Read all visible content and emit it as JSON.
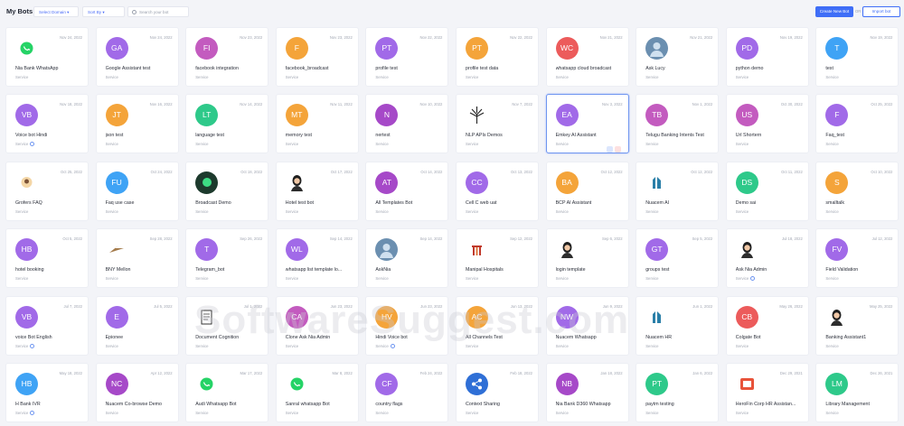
{
  "header": {
    "title": "My Bots",
    "select_team": "Select Domain",
    "sort_by": "Sort By",
    "search_placeholder": "Search your bot",
    "create_label": "Create New Bot",
    "or_label": "OR",
    "import_label": "Import bot"
  },
  "watermark": "SoftwareSuggest.com",
  "bots": [
    {
      "name": "Nia Bank WhatsApp",
      "date": "Nov 24, 2022",
      "type": "Service",
      "initials": "",
      "color": "#ffffff",
      "icon": "whatsapp-logo-icon"
    },
    {
      "name": "Google Assistant test",
      "date": "Nov 24, 2022",
      "type": "Service",
      "initials": "GA",
      "color": "#a16ae8"
    },
    {
      "name": "facebook integration",
      "date": "Nov 23, 2022",
      "type": "Service",
      "initials": "FI",
      "color": "#c35bbf"
    },
    {
      "name": "facebook_broadcast",
      "date": "Nov 23, 2022",
      "type": "Service",
      "initials": "F",
      "color": "#f4a43a"
    },
    {
      "name": "profile test",
      "date": "Nov 22, 2022",
      "type": "Service",
      "initials": "PT",
      "color": "#a16ae8"
    },
    {
      "name": "profile test data",
      "date": "Nov 22, 2022",
      "type": "Service",
      "initials": "PT",
      "color": "#f4a43a"
    },
    {
      "name": "whatsapp cloud broadcast",
      "date": "Nov 21, 2022",
      "type": "Service",
      "initials": "WC",
      "color": "#ec5b5b"
    },
    {
      "name": "Ask Lucy",
      "date": "Nov 21, 2022",
      "type": "Service",
      "initials": "",
      "color": "#6b8fb0",
      "icon": "lucy-avatar-icon"
    },
    {
      "name": "python demo",
      "date": "Nov 19, 2022",
      "type": "Service",
      "initials": "PD",
      "color": "#a16ae8"
    },
    {
      "name": "test",
      "date": "Nov 19, 2022",
      "type": "Service",
      "initials": "T",
      "color": "#3fa3f5"
    },
    {
      "name": "Voice bot Hindi",
      "date": "Nov 18, 2022",
      "type": "Service",
      "initials": "VB",
      "color": "#a16ae8",
      "voice": true
    },
    {
      "name": "json test",
      "date": "Nov 16, 2022",
      "type": "Service",
      "initials": "JT",
      "color": "#f4a43a"
    },
    {
      "name": "language test",
      "date": "Nov 14, 2022",
      "type": "Service",
      "initials": "LT",
      "color": "#2ec98a"
    },
    {
      "name": "memory test",
      "date": "Nov 11, 2022",
      "type": "Service",
      "initials": "MT",
      "color": "#f4a43a"
    },
    {
      "name": "nertest",
      "date": "Nov 10, 2022",
      "type": "Service",
      "initials": "N",
      "color": "#a649c8"
    },
    {
      "name": "NLP APIs Demos",
      "date": "Nov 7, 2022",
      "type": "Service",
      "initials": "",
      "color": "#ffffff",
      "icon": "tree-logo-icon"
    },
    {
      "name": "Emkey AI Assistant",
      "date": "Nov 3, 2022",
      "type": "Service",
      "initials": "EA",
      "color": "#a16ae8",
      "highlight": true
    },
    {
      "name": "Telugu Banking Intents Test",
      "date": "Nov 1, 2022",
      "type": "Service",
      "initials": "TB",
      "color": "#c35bbf"
    },
    {
      "name": "Url Shortern",
      "date": "Oct 30, 2022",
      "type": "Service",
      "initials": "US",
      "color": "#c35bbf"
    },
    {
      "name": "Faq_test",
      "date": "Oct 25, 2022",
      "type": "Service",
      "initials": "F",
      "color": "#a16ae8"
    },
    {
      "name": "Grofers FAQ",
      "date": "Oct 25, 2022",
      "type": "Service",
      "initials": "",
      "color": "#ffffff",
      "icon": "grofers-logo-icon"
    },
    {
      "name": "Faq use case",
      "date": "Oct 24, 2022",
      "type": "Service",
      "initials": "FU",
      "color": "#3fa3f5"
    },
    {
      "name": "Broadcast Demo",
      "date": "Oct 18, 2022",
      "type": "Service",
      "initials": "",
      "color": "#1d3a2d",
      "icon": "broadcast-logo-icon"
    },
    {
      "name": "Hotel test bot",
      "date": "Oct 17, 2022",
      "type": "Service",
      "initials": "",
      "color": "#ffffff",
      "icon": "woman-avatar-icon"
    },
    {
      "name": "All Templates Bot",
      "date": "Oct 14, 2022",
      "type": "Service",
      "initials": "AT",
      "color": "#a649c8"
    },
    {
      "name": "Cell C web uat",
      "date": "Oct 13, 2022",
      "type": "Service",
      "initials": "CC",
      "color": "#a16ae8"
    },
    {
      "name": "BCP AI Assistant",
      "date": "Oct 12, 2022",
      "type": "Service",
      "initials": "BA",
      "color": "#f4a43a"
    },
    {
      "name": "Nuacem AI",
      "date": "Oct 12, 2022",
      "type": "Service",
      "initials": "",
      "color": "#ffffff",
      "icon": "nuacem-logo-icon"
    },
    {
      "name": "Demo sai",
      "date": "Oct 11, 2022",
      "type": "Service",
      "initials": "DS",
      "color": "#2ec98a"
    },
    {
      "name": "smalltalk",
      "date": "Oct 10, 2022",
      "type": "Service",
      "initials": "S",
      "color": "#f4a43a"
    },
    {
      "name": "hotel booking",
      "date": "Oct 5, 2022",
      "type": "Service",
      "initials": "HB",
      "color": "#a16ae8"
    },
    {
      "name": "BNY Mellon",
      "date": "Sep 28, 2022",
      "type": "Service",
      "initials": "",
      "color": "#ffffff",
      "icon": "bny-logo-icon"
    },
    {
      "name": "Telegram_bot",
      "date": "Sep 26, 2022",
      "type": "Service",
      "initials": "T",
      "color": "#a16ae8"
    },
    {
      "name": "whatsapp list template lo...",
      "date": "Sep 14, 2022",
      "type": "Service",
      "initials": "WL",
      "color": "#a16ae8"
    },
    {
      "name": "AskNia",
      "date": "Sep 14, 2022",
      "type": "Service",
      "initials": "",
      "color": "#6b8fb0",
      "icon": "nia-avatar-icon"
    },
    {
      "name": "Manipal Hospitals",
      "date": "Sep 12, 2022",
      "type": "Service",
      "initials": "",
      "color": "#ffffff",
      "icon": "manipal-logo-icon"
    },
    {
      "name": "login template",
      "date": "Sep 6, 2022",
      "type": "Service",
      "initials": "",
      "color": "#ffffff",
      "icon": "woman-avatar-icon"
    },
    {
      "name": "groups test",
      "date": "Sep 5, 2022",
      "type": "Service",
      "initials": "GT",
      "color": "#a16ae8"
    },
    {
      "name": "Ask Nia Admin",
      "date": "Jul 18, 2022",
      "type": "Service",
      "initials": "",
      "color": "#ffffff",
      "icon": "woman-avatar-icon",
      "voice": true
    },
    {
      "name": "Field Validation",
      "date": "Jul 12, 2022",
      "type": "Service",
      "initials": "FV",
      "color": "#a16ae8"
    },
    {
      "name": "voice Bot English",
      "date": "Jul 7, 2022",
      "type": "Service",
      "initials": "VB",
      "color": "#a16ae8",
      "voice": true
    },
    {
      "name": "Epionee",
      "date": "Jul 5, 2022",
      "type": "Service",
      "initials": "E",
      "color": "#a16ae8"
    },
    {
      "name": "Document Cognition",
      "date": "Jul 1, 2022",
      "type": "Service",
      "initials": "",
      "color": "#ffffff",
      "icon": "document-logo-icon"
    },
    {
      "name": "Clone Ask Nia Admin",
      "date": "Jun 23, 2022",
      "type": "Service",
      "initials": "CA",
      "color": "#c35bbf"
    },
    {
      "name": "Hindi Voice bot",
      "date": "Jun 23, 2022",
      "type": "Service",
      "initials": "HV",
      "color": "#f4a43a",
      "voice": true
    },
    {
      "name": "All Channels Test",
      "date": "Jun 13, 2022",
      "type": "Service",
      "initials": "AC",
      "color": "#f4a43a"
    },
    {
      "name": "Nuacem Whatsapp",
      "date": "Jun 9, 2022",
      "type": "Service",
      "initials": "NW",
      "color": "#a16ae8"
    },
    {
      "name": "Nuacem HR",
      "date": "Jun 1, 2022",
      "type": "Service",
      "initials": "",
      "color": "#ffffff",
      "icon": "nuacem-logo-icon"
    },
    {
      "name": "Colgate Bot",
      "date": "May 26, 2022",
      "type": "Service",
      "initials": "CB",
      "color": "#ec5b5b"
    },
    {
      "name": "Banking Assistant1",
      "date": "May 25, 2022",
      "type": "Service",
      "initials": "",
      "color": "#ffffff",
      "icon": "woman-avatar-icon"
    },
    {
      "name": "H Bank IVR",
      "date": "May 18, 2022",
      "type": "Service",
      "initials": "HB",
      "color": "#3fa3f5",
      "voice": true
    },
    {
      "name": "Nuacem Co-browse Demo",
      "date": "Apr 12, 2022",
      "type": "Service",
      "initials": "NC",
      "color": "#a649c8"
    },
    {
      "name": "Audi Whatsapp Bot",
      "date": "Mar 17, 2022",
      "type": "Service",
      "initials": "",
      "color": "#ffffff",
      "icon": "whatsapp-logo-icon"
    },
    {
      "name": "Sanral whatsapp Bot",
      "date": "Mar 8, 2022",
      "type": "Service",
      "initials": "",
      "color": "#ffffff",
      "icon": "whatsapp-logo-icon"
    },
    {
      "name": "country flags",
      "date": "Feb 24, 2022",
      "type": "Service",
      "initials": "CF",
      "color": "#a16ae8"
    },
    {
      "name": "Context Sharing",
      "date": "Feb 18, 2022",
      "type": "Service",
      "initials": "",
      "color": "#2f6fd6",
      "icon": "share-icon"
    },
    {
      "name": "Nia Bank D360 Whatsapp",
      "date": "Jan 18, 2022",
      "type": "Service",
      "initials": "NB",
      "color": "#a649c8"
    },
    {
      "name": "paytm testing",
      "date": "Jan 6, 2022",
      "type": "Service",
      "initials": "PT",
      "color": "#2ec98a"
    },
    {
      "name": "HeroFin Corp HR Assistan...",
      "date": "Dec 29, 2021",
      "type": "Service",
      "initials": "",
      "color": "#ffffff",
      "icon": "herofin-logo-icon"
    },
    {
      "name": "Library Management",
      "date": "Dec 26, 2021",
      "type": "Service",
      "initials": "LM",
      "color": "#2ec98a"
    }
  ]
}
